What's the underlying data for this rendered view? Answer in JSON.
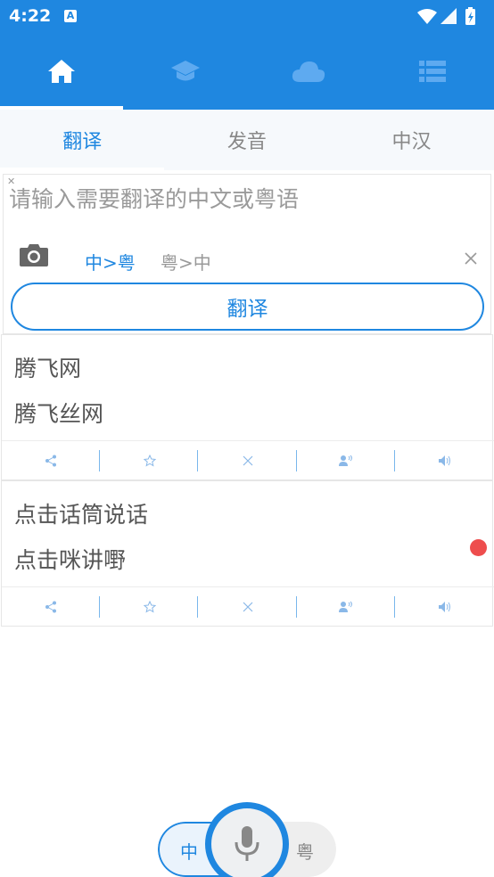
{
  "status_bar": {
    "time": "4:22",
    "notif_icon": "A"
  },
  "nav": [
    {
      "icon": "home-icon",
      "active": true
    },
    {
      "icon": "graduation-cap-icon",
      "active": false
    },
    {
      "icon": "cloud-icon",
      "active": false
    },
    {
      "icon": "list-icon",
      "active": false
    }
  ],
  "tabs": [
    {
      "label": "翻译",
      "active": true
    },
    {
      "label": "发音",
      "active": false
    },
    {
      "label": "中汉",
      "active": false
    }
  ],
  "input": {
    "placeholder": "请输入需要翻译的中文或粤语",
    "dir_zh_to_yue": "中>粤",
    "dir_yue_to_zh": "粤>中",
    "translate_label": "翻译"
  },
  "results": [
    {
      "source": "腾飞网",
      "target": "腾飞丝网"
    },
    {
      "source": "点击话筒说话",
      "target": "点击咪讲嘢"
    }
  ],
  "voice": {
    "left_label": "中",
    "right_label": "粤"
  },
  "colors": {
    "primary": "#1f87e0",
    "record_dot": "#ee4d4d"
  }
}
